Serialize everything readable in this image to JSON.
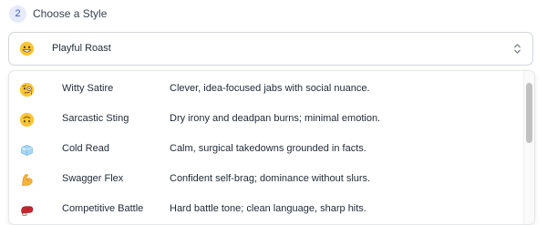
{
  "step": {
    "number": "2",
    "title": "Choose a Style"
  },
  "select": {
    "selected_label": "Playful Roast",
    "selected_icon": "grinning-face-emoji"
  },
  "options": [
    {
      "name": "Witty Satire",
      "description": "Clever, idea-focused jabs with social nuance.",
      "icon": "monocle-face-emoji"
    },
    {
      "name": "Sarcastic Sting",
      "description": "Dry irony and deadpan burns; minimal emotion.",
      "icon": "upside-down-face-emoji"
    },
    {
      "name": "Cold Read",
      "description": "Calm, surgical takedowns grounded in facts.",
      "icon": "ice-cube-emoji"
    },
    {
      "name": "Swagger Flex",
      "description": "Confident self-brag; dominance without slurs.",
      "icon": "flexed-biceps-emoji"
    },
    {
      "name": "Competitive Battle",
      "description": "Hard battle tone; clean language, sharp hits.",
      "icon": "boxing-glove-emoji"
    }
  ],
  "colors": {
    "accent": "#3b5bdb",
    "badge_bg": "#e6ebfb",
    "border": "#d1d5db"
  }
}
